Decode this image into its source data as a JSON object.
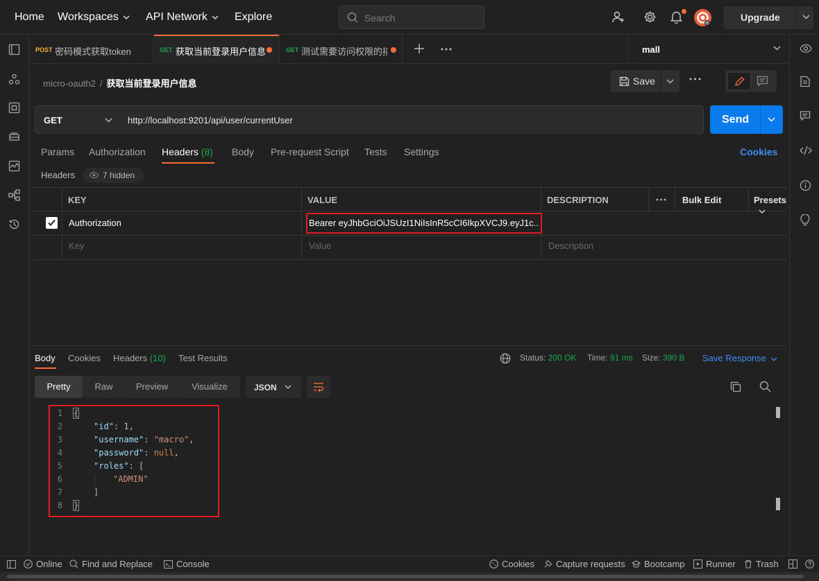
{
  "topbar": {
    "nav": [
      "Home",
      "Workspaces",
      "API Network",
      "Explore"
    ],
    "search_placeholder": "Search",
    "upgrade_label": "Upgrade"
  },
  "tabs": [
    {
      "method": "POST",
      "title": "密码模式获取token",
      "method_color": "#ffb13b",
      "unsaved": false,
      "active": false
    },
    {
      "method": "GET",
      "title": "获取当前登录用户信息",
      "method_color": "#1fa84f",
      "unsaved": true,
      "active": true
    },
    {
      "method": "GET",
      "title": "测试需要访问权限的接口",
      "method_color": "#1fa84f",
      "unsaved": true,
      "active": false
    }
  ],
  "environment": "mall",
  "breadcrumb": {
    "collection": "micro-oauth2",
    "separator": "/",
    "request": "获取当前登录用户信息"
  },
  "save_label": "Save",
  "request": {
    "method": "GET",
    "url": "http://localhost:9201/api/user/currentUser",
    "send_label": "Send"
  },
  "request_tabs": {
    "params": "Params",
    "authorization": "Authorization",
    "headers": "Headers",
    "headers_count": "(8)",
    "body": "Body",
    "prerequest": "Pre-request Script",
    "tests": "Tests",
    "settings": "Settings",
    "cookies": "Cookies"
  },
  "headers_section": {
    "label": "Headers",
    "hidden": "7 hidden"
  },
  "headers_table": {
    "columns": {
      "key": "KEY",
      "value": "VALUE",
      "description": "DESCRIPTION"
    },
    "bulk_edit": "Bulk Edit",
    "presets": "Presets",
    "rows": [
      {
        "checked": true,
        "key": "Authorization",
        "value": "Bearer eyJhbGciOiJSUzI1NiIsInR5cCI6IkpXVCJ9.eyJ1c..."
      }
    ],
    "placeholders": {
      "key": "Key",
      "value": "Value",
      "description": "Description"
    }
  },
  "response": {
    "tabs": {
      "body": "Body",
      "cookies": "Cookies",
      "headers": "Headers",
      "headers_count": "(10)",
      "tests": "Test Results"
    },
    "status_label": "Status:",
    "status_value": "200 OK",
    "time_label": "Time:",
    "time_value": "91 ms",
    "size_label": "Size:",
    "size_value": "390 B",
    "save_response": "Save Response",
    "views": [
      "Pretty",
      "Raw",
      "Preview",
      "Visualize"
    ],
    "format": "JSON",
    "line_numbers": [
      "1",
      "2",
      "3",
      "4",
      "5",
      "6",
      "7",
      "8"
    ],
    "json": {
      "open": "{",
      "id_key": "\"id\"",
      "id_val": "1",
      "username_key": "\"username\"",
      "username_val": "\"macro\"",
      "password_key": "\"password\"",
      "password_val": "null",
      "roles_key": "\"roles\"",
      "roles_open": "[",
      "role_item": "\"ADMIN\"",
      "roles_close": "]",
      "close": "}"
    }
  },
  "statusbar": {
    "online": "Online",
    "find_replace": "Find and Replace",
    "console": "Console",
    "cookies": "Cookies",
    "capture": "Capture requests",
    "bootcamp": "Bootcamp",
    "runner": "Runner",
    "trash": "Trash"
  }
}
